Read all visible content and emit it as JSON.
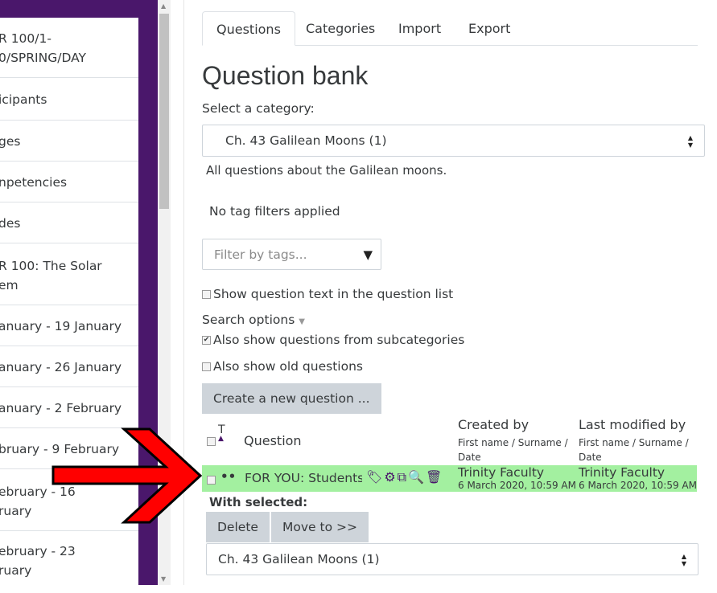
{
  "sidebar": {
    "items": [
      {
        "label": "R 100/1-",
        "label2": "0/SPRING/DAY"
      },
      {
        "label": "icipants"
      },
      {
        "label": "ges"
      },
      {
        "label": "npetencies"
      },
      {
        "label": "des"
      },
      {
        "label": "R 100: The Solar",
        "label2": "em"
      },
      {
        "label": "anuary - 19 January"
      },
      {
        "label": "anuary - 26 January"
      },
      {
        "label": "anuary - 2 February"
      },
      {
        "label": "bruary - 9 February"
      },
      {
        "label": "ebruary - 16",
        "label2": "ruary"
      },
      {
        "label": "ebruary - 23",
        "label2": "ruary"
      }
    ]
  },
  "tabs": [
    {
      "label": "Questions",
      "active": true
    },
    {
      "label": "Categories"
    },
    {
      "label": "Import"
    },
    {
      "label": "Export"
    }
  ],
  "page_title": "Question bank",
  "category_label": "Select a category:",
  "category_value": "Ch. 43 Galilean Moons (1)",
  "category_description": "All questions about the Galilean moons.",
  "tag_status": "No tag filters applied",
  "tag_filter_placeholder": "Filter by tags...",
  "options": {
    "show_text": {
      "label": "Show question text in the question list",
      "checked": false
    },
    "search_options": "Search options",
    "subcategories": {
      "label": "Also show questions from subcategories",
      "checked": true
    },
    "old": {
      "label": "Also show old questions",
      "checked": false
    }
  },
  "create_button": "Create a new question ...",
  "table": {
    "col_type": "T",
    "col_question": "Question",
    "col_created": "Created by",
    "col_created_sub": "First name / Surname / Date",
    "col_modified": "Last modified by",
    "col_modified_sub": "First name / Surname / Date",
    "rows": [
      {
        "type": "••",
        "question": "FOR YOU: Students \\",
        "created_by": "Trinity Faculty",
        "created_date": "6 March 2020, 10:59 AM",
        "modified_by": "Trinity Faculty",
        "modified_date": "6 March 2020, 10:59 AM",
        "highlight": "#a3f0a0"
      }
    ]
  },
  "with_selected": "With selected:",
  "delete_button": "Delete",
  "move_button": "Move to >>",
  "move_target": "Ch. 43 Galilean Moons (1)",
  "colors": {
    "sidebar": "#4a176b",
    "arrow": "#ff0000",
    "row_highlight": "#a3f0a0"
  }
}
